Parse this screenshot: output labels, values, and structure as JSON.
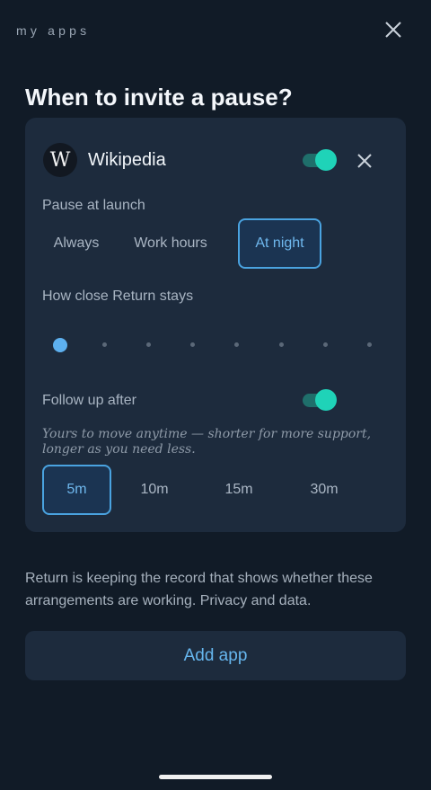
{
  "header": {
    "section_label": "my apps",
    "close_icon": "close-icon",
    "title": "When to invite a pause?"
  },
  "app_card": {
    "icon_letter": "W",
    "app_name": "Wikipedia",
    "enabled": true,
    "pause_at_launch": {
      "label": "Pause at launch",
      "options": [
        "Always",
        "Work hours",
        "At night"
      ],
      "selected": "At night"
    },
    "stay_close": {
      "label": "How close Return stays",
      "steps": 8,
      "selected_step": 1
    },
    "follow_up": {
      "label": "Follow up after",
      "enabled": true,
      "note": "Yours to move anytime — shorter for more support, longer as you need less.",
      "options": [
        "5m",
        "10m",
        "15m",
        "30m"
      ],
      "selected": "5m"
    }
  },
  "footer": {
    "text": "Return is keeping the record that shows whether these arrangements are working. Privacy and data.",
    "add_button_label": "Add app"
  },
  "colors": {
    "background": "#111b27",
    "card": "#1d2b3d",
    "accent_teal": "#1fd3b8",
    "accent_blue": "#4aa3e0"
  }
}
